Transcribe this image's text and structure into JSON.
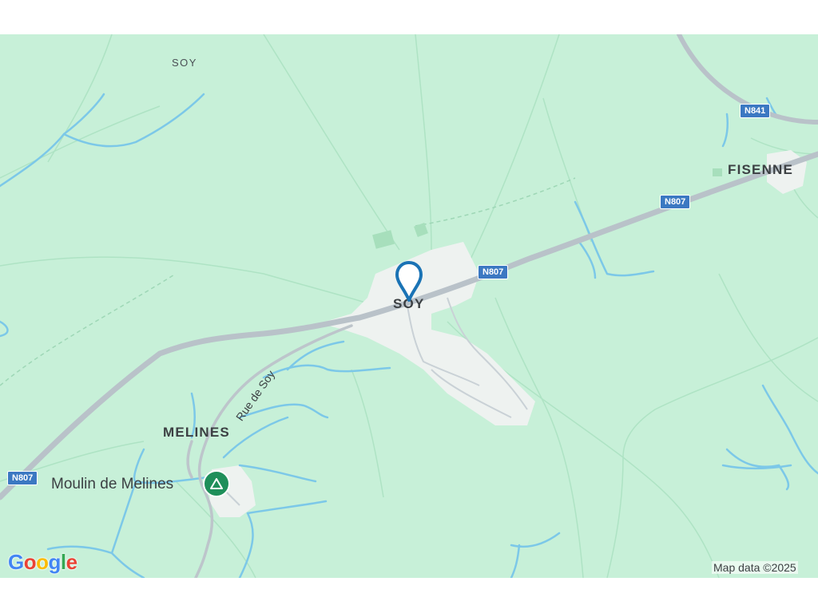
{
  "map": {
    "places": {
      "soy_top": "SOY",
      "soy_center": "SOY",
      "fisenne": "FISENNE",
      "melines": "MELINES"
    },
    "road_shields": {
      "n841": "N841",
      "n807_east": "N807",
      "n807_center": "N807",
      "n807_west": "N807"
    },
    "street_label": "Rue de Soy",
    "poi": {
      "label": "Moulin de Melines",
      "icon": "campground-icon"
    },
    "pin_icon": "location-pin-icon",
    "colors": {
      "land": "#c7f0d8",
      "water": "#7cc8e8",
      "road": "#b9c2c9",
      "built_up": "#eef2f0",
      "shield": "#3b78c2",
      "pin": "#1a73b5",
      "poi": "#1f8f5a"
    }
  },
  "branding": {
    "logo_letters": [
      "G",
      "o",
      "o",
      "g",
      "l",
      "e"
    ],
    "logo_colors": [
      "#4285F4",
      "#EA4335",
      "#FBBC05",
      "#4285F4",
      "#34A853",
      "#EA4335"
    ],
    "attribution": "Map data ©2025"
  }
}
